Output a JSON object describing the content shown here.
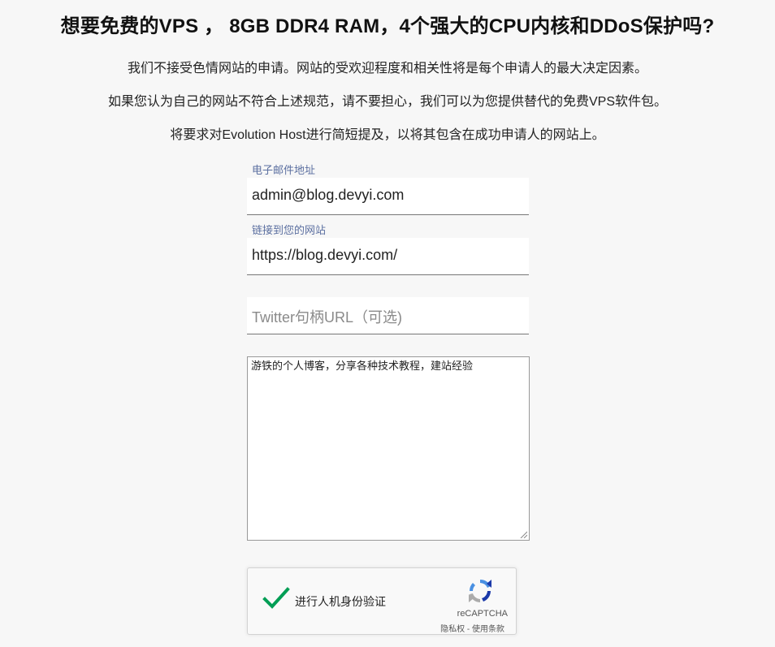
{
  "header": {
    "title": "想要免费的VPS ， 8GB DDR4 RAM，4个强大的CPU内核和DDoS保护吗?"
  },
  "intro": {
    "line1": "我们不接受色情网站的申请。网站的受欢迎程度和相关性将是每个申请人的最大决定因素。",
    "line2": "如果您认为自己的网站不符合上述规范，请不要担心，我们可以为您提供替代的免费VPS软件包。",
    "line3": "将要求对Evolution Host进行简短提及，以将其包含在成功申请人的网站上。"
  },
  "form": {
    "email_label": "电子邮件地址",
    "email_value": "admin@blog.devyi.com",
    "website_label": "链接到您的网站",
    "website_value": "https://blog.devyi.com/",
    "twitter_placeholder": "Twitter句柄URL（可选)",
    "description_value": "游铁的个人博客，分享各种技术教程，建站经验"
  },
  "recaptcha": {
    "label": "进行人机身份验证",
    "brand": "reCAPTCHA",
    "privacy": "隐私权",
    "separator": " - ",
    "terms": "使用条款",
    "checked": true
  },
  "colors": {
    "background": "#f7f7f7",
    "label": "#5b6fa0",
    "check": "#009e55"
  }
}
